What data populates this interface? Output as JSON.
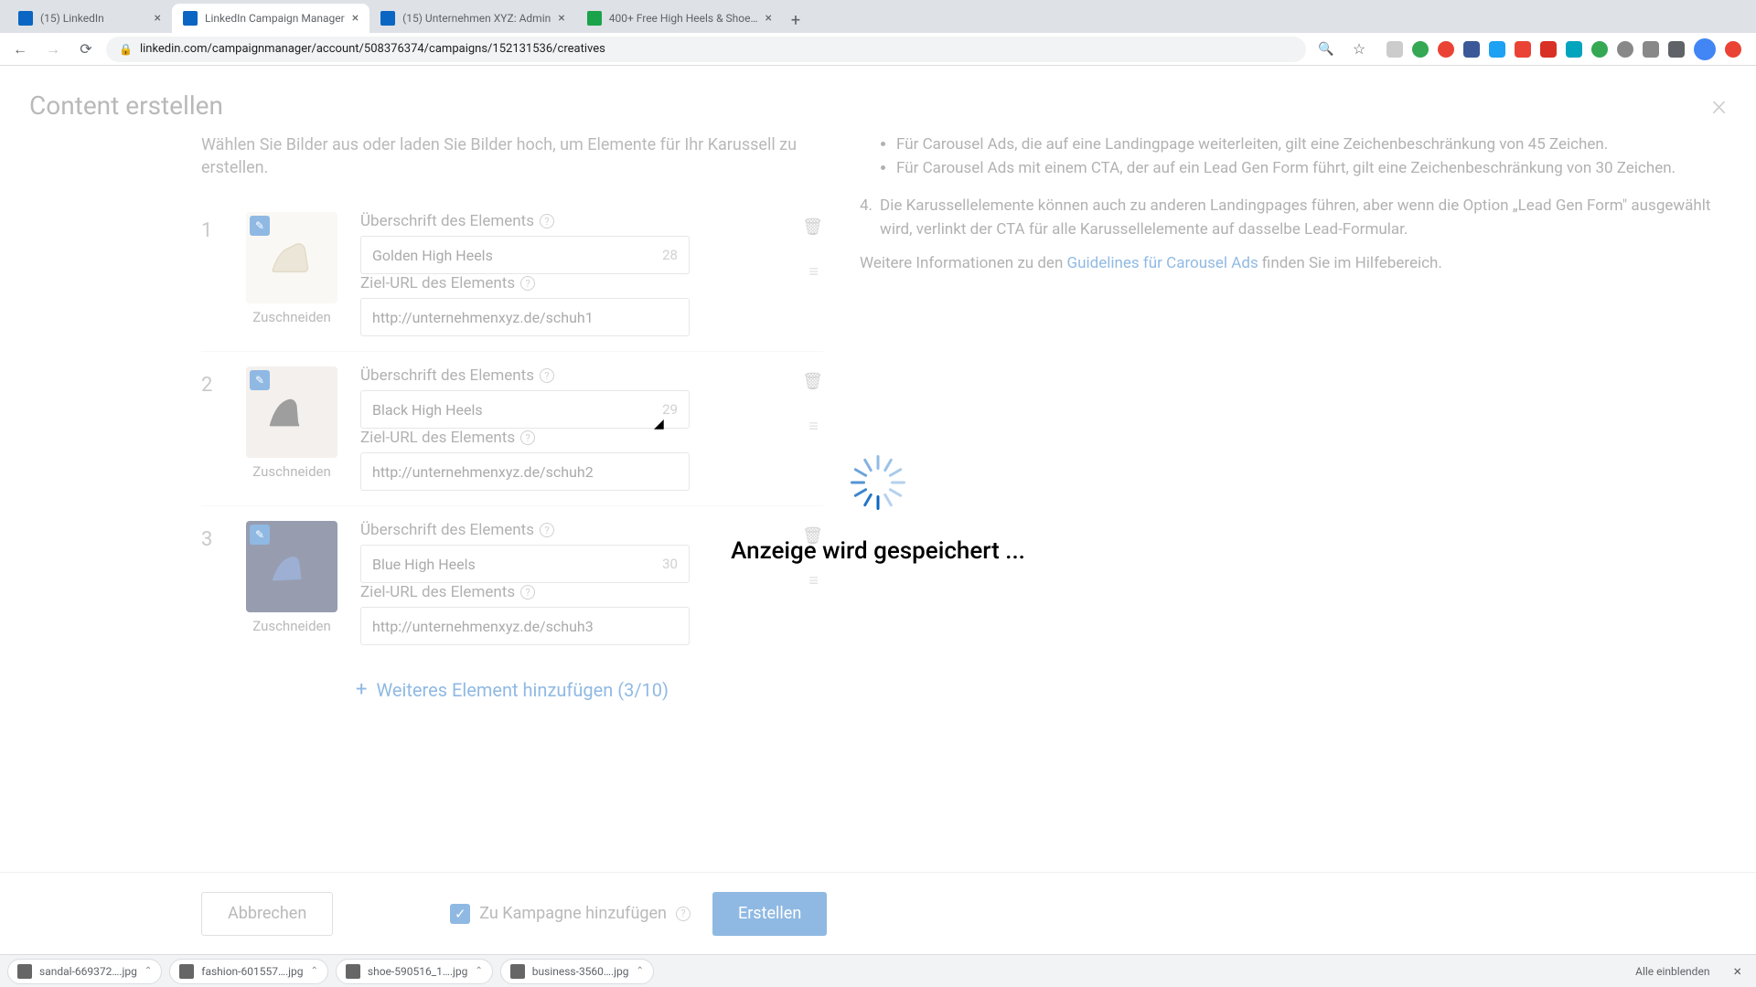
{
  "browser": {
    "tabs": [
      {
        "title": "(15) LinkedIn",
        "favicon": "#0a66c2"
      },
      {
        "title": "LinkedIn Campaign Manager",
        "favicon": "#0a66c2",
        "active": true
      },
      {
        "title": "(15) Unternehmen XYZ: Admin",
        "favicon": "#0a66c2"
      },
      {
        "title": "400+ Free High Heels & Shoe…",
        "favicon": "#1aa34a"
      }
    ],
    "url": "linkedin.com/campaignmanager/account/508376374/campaigns/152131536/creatives",
    "ext_colors": [
      "#ccc",
      "#34a853",
      "#ea4335",
      "#3b5998",
      "#1da1f2",
      "#ea4335",
      "#d93025",
      "#00a4bd",
      "#34a853",
      "#888",
      "#888",
      "#5f6368"
    ]
  },
  "modal": {
    "title": "Content erstellen",
    "intro": "Wählen Sie Bilder aus oder laden Sie Bilder hoch, um Elemente für Ihr Karussell zu erstellen.",
    "headline_label": "Überschrift des Elements",
    "url_label": "Ziel-URL des Elements",
    "crop_label": "Zuschneiden",
    "add_more": "Weiteres Element hinzufügen (3/10)"
  },
  "items": [
    {
      "num": "1",
      "headline": "Golden High Heels",
      "count": "28",
      "url": "http://unternehmenxyz.de/schuh1"
    },
    {
      "num": "2",
      "headline": "Black High Heels",
      "count": "29",
      "url": "http://unternehmenxyz.de/schuh2"
    },
    {
      "num": "3",
      "headline": "Blue High Heels",
      "count": "30",
      "url": "http://unternehmenxyz.de/schuh3"
    }
  ],
  "help": {
    "bullet1": "Für Carousel Ads, die auf eine Landingpage weiterleiten, gilt eine Zeichenbeschränkung von 45 Zeichen.",
    "bullet2": "Für Carousel Ads mit einem CTA, der auf ein Lead Gen Form führt, gilt eine Zeichenbeschränkung von 30 Zeichen.",
    "num4_prefix": "4.",
    "num4": "Die Karussellelemente können auch zu anderen Landingpages führen, aber wenn die Option „Lead Gen Form\" ausgewählt wird, verlinkt der CTA für alle Karussellelemente auf dasselbe Lead-Formular.",
    "more_prefix": "Weitere Informationen zu den ",
    "more_link": "Guidelines für Carousel Ads",
    "more_suffix": " finden Sie im Hilfebereich."
  },
  "footer": {
    "cancel": "Abbrechen",
    "add_to_campaign": "Zu Kampagne hinzufügen",
    "create": "Erstellen"
  },
  "loading": {
    "text": "Anzeige wird gespeichert ..."
  },
  "downloads": {
    "items": [
      "sandal-669372….jpg",
      "fashion-601557….jpg",
      "shoe-590516_1….jpg",
      "business-3560….jpg"
    ],
    "show_all": "Alle einblenden"
  }
}
